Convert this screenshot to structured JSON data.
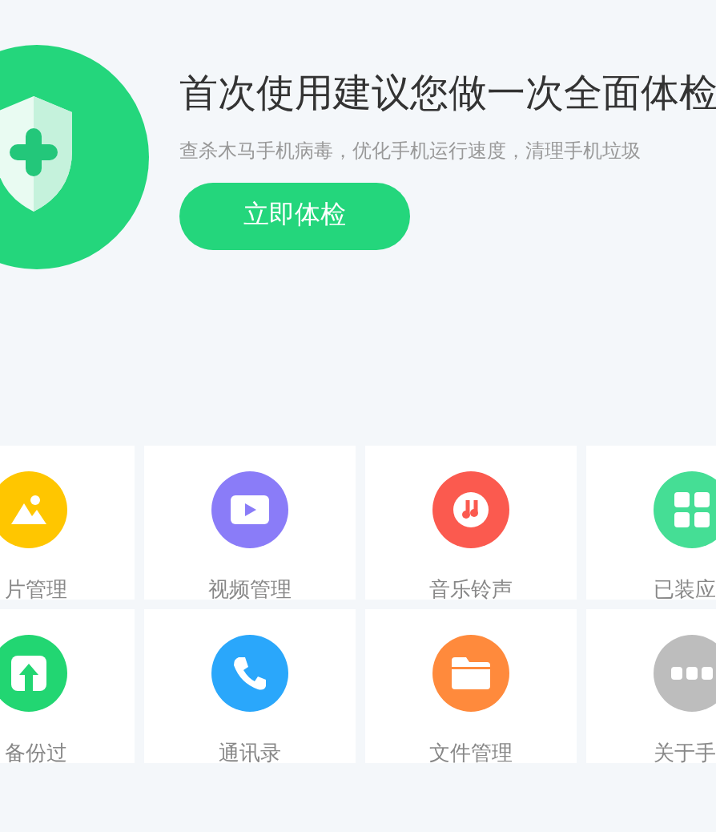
{
  "hero": {
    "title": "首次使用建议您做一次全面体检",
    "subtitle": "查杀木马手机病毒，优化手机运行速度，清理手机垃圾",
    "button": "立即体检"
  },
  "tiles": [
    {
      "kind": "photo",
      "label": "片管理",
      "color": "#ffc600"
    },
    {
      "kind": "video",
      "label": "视频管理",
      "color": "#8a7cf8"
    },
    {
      "kind": "music",
      "label": "音乐铃声",
      "color": "#fb5a4f"
    },
    {
      "kind": "apps",
      "label": "已装应",
      "color": "#45de95"
    },
    {
      "kind": "backup",
      "label": "备份过",
      "color": "#22d672"
    },
    {
      "kind": "contacts",
      "label": "通讯录",
      "color": "#2aa7fb"
    },
    {
      "kind": "files",
      "label": "文件管理",
      "color": "#ff8a3c"
    },
    {
      "kind": "more",
      "label": "关于手",
      "color": "#bdbdbd"
    }
  ]
}
